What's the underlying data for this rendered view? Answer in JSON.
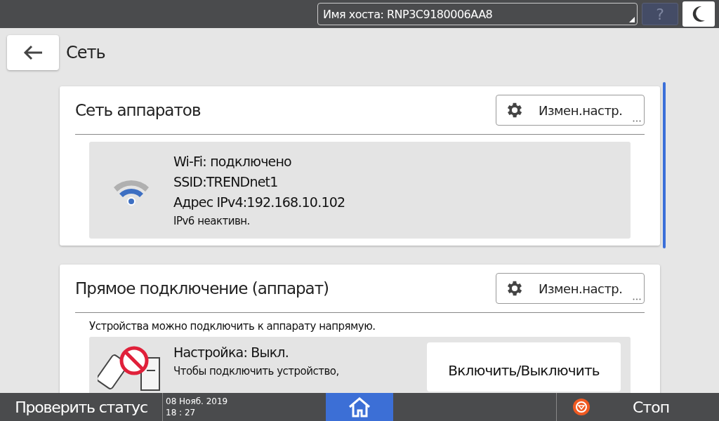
{
  "top_bar": {
    "host_field": "Имя хоста: RNP3C9180006AA8",
    "help": "?"
  },
  "header": {
    "title": "Сеть"
  },
  "cards": [
    {
      "kind": "wifi",
      "title": "Сеть аппаратов",
      "button": "Измен.настр.",
      "lines": [
        "Wi-Fi: подключено",
        "SSID:TRENDnet1",
        "Адрес IPv4:192.168.10.102"
      ],
      "note": "IPv6 неактивн."
    },
    {
      "kind": "direct",
      "title": "Прямое подключение (аппарат)",
      "button": "Измен.настр.",
      "intro": "Устройства можно подключить к аппарату напрямую.",
      "lines": [
        "Настройка: Выкл."
      ],
      "note": "Чтобы подключить устройство,",
      "action": "Включить/Выключить"
    }
  ],
  "bottom_bar": {
    "status": "Проверить статус",
    "date": "08 Нояб. 2019",
    "time": "18 : 27",
    "stop": "Стоп"
  }
}
